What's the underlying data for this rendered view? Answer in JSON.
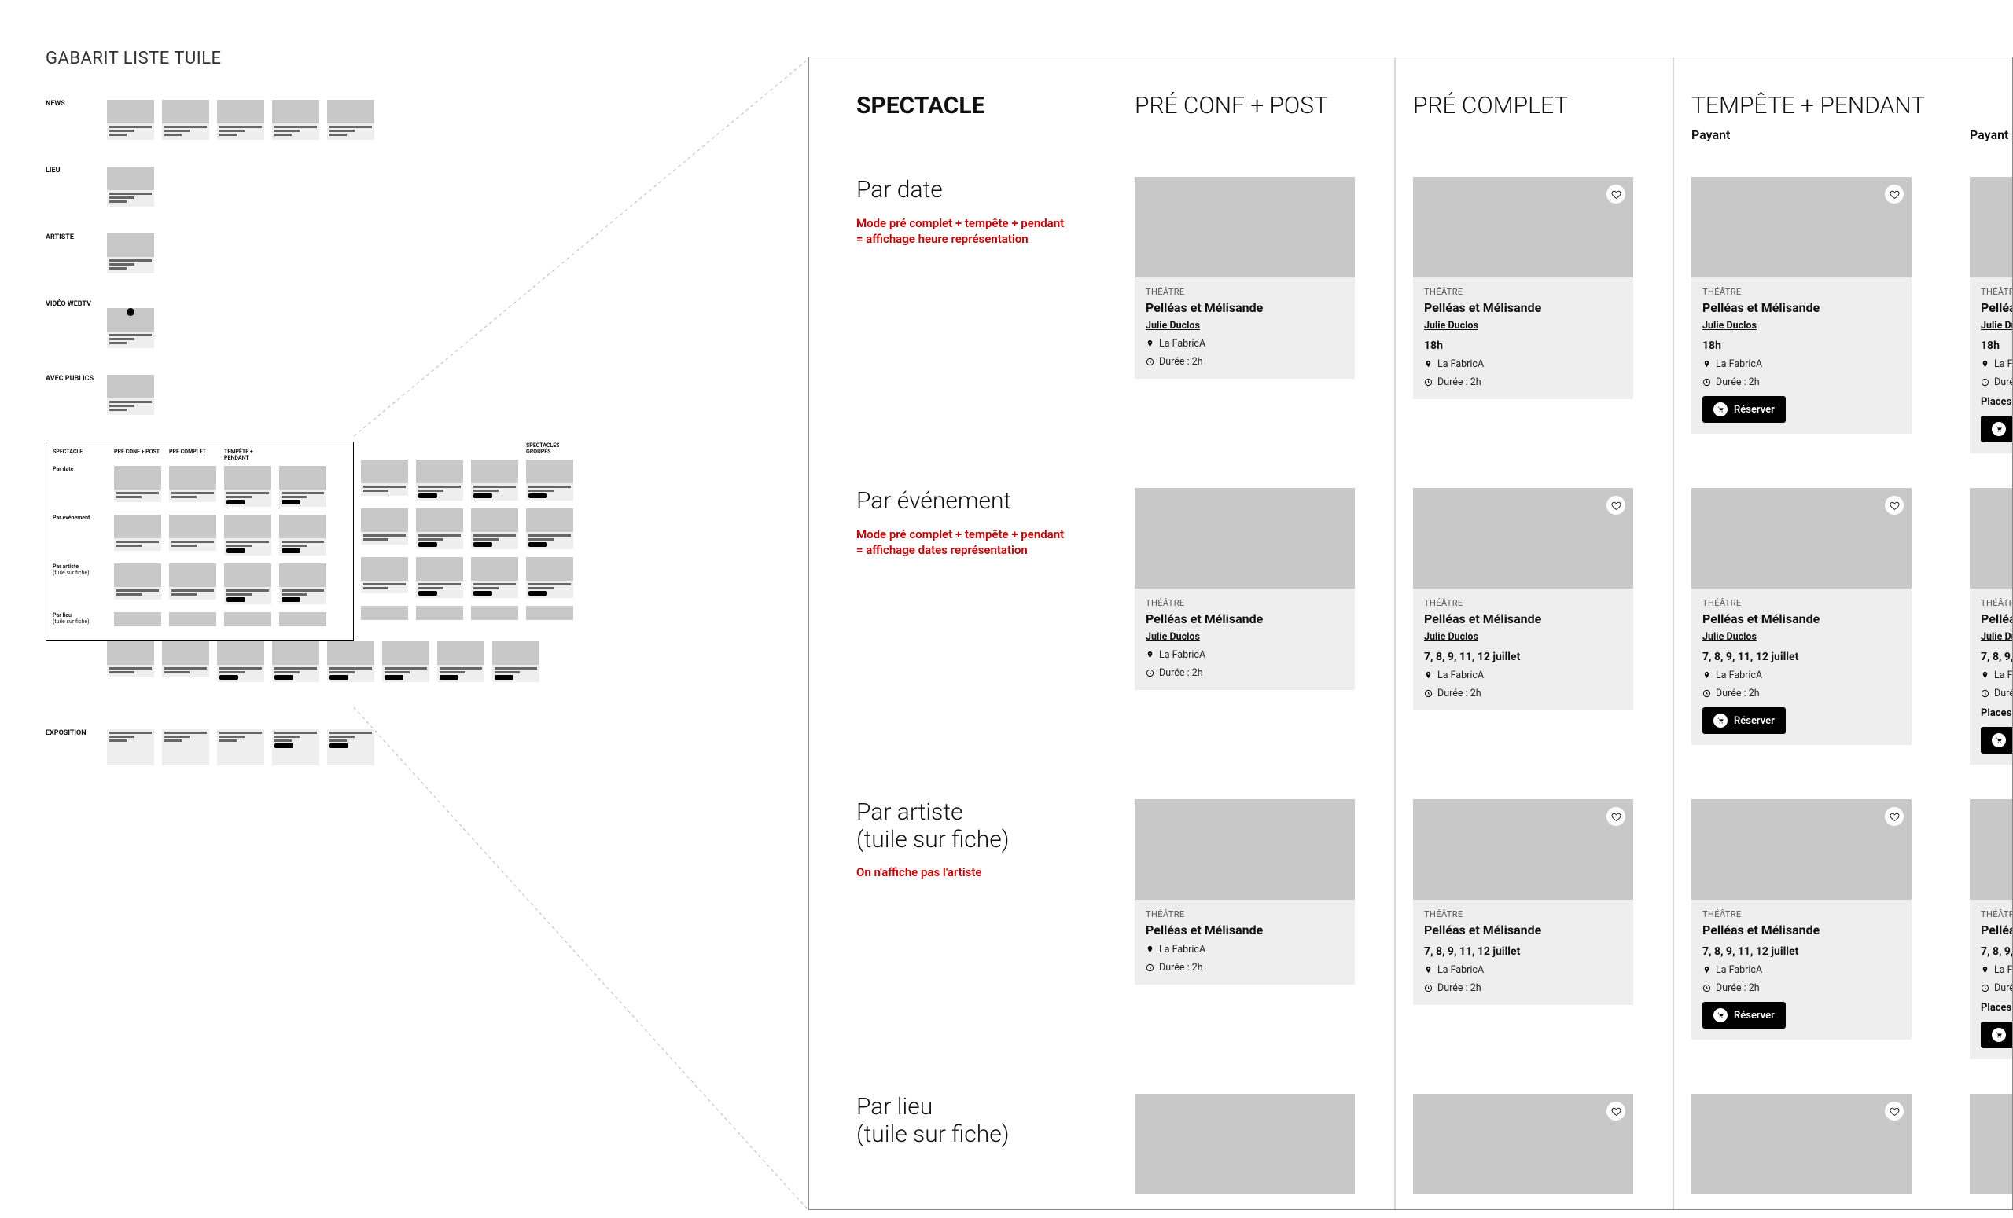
{
  "page_title": "GABARIT LISTE TUILE",
  "left": {
    "groups": [
      {
        "id": "news",
        "label": "NEWS"
      },
      {
        "id": "lieu",
        "label": "LIEU"
      },
      {
        "id": "artiste",
        "label": "ARTISTE"
      },
      {
        "id": "video",
        "label": "VIDÉO WEBTV"
      },
      {
        "id": "publics",
        "label": "AVEC PUBLICS"
      }
    ],
    "matrix": {
      "cols": [
        "SPECTACLE",
        "PRÉ CONF + POST",
        "PRÉ COMPLET",
        "TEMPÊTE + PENDANT",
        "",
        "",
        "",
        "SPECTACLES GROUPÉS"
      ],
      "rows": [
        "Par date",
        "Par événement",
        "Par artiste (tuile sur fiche)",
        "Par lieu (tuile sur fiche)"
      ]
    },
    "expo_label": "EXPOSITION"
  },
  "zoom": {
    "cols": [
      {
        "head": "SPECTACLE",
        "bold": true
      },
      {
        "head": "PRÉ CONF + POST"
      },
      {
        "head": "PRÉ COMPLET"
      },
      {
        "head": "TEMPÊTE + PENDANT",
        "sub": "Payant"
      },
      {
        "head": "",
        "sub": "Payant places remises en"
      }
    ],
    "rows": [
      {
        "id": "par-date",
        "title": "Par date",
        "note": "Mode pré complet + tempête + pendant\n= affichage heure représentation"
      },
      {
        "id": "par-evenement",
        "title": "Par événement",
        "note": "Mode pré complet + tempête + pendant\n= affichage dates représentation"
      },
      {
        "id": "par-artiste",
        "title": "Par artiste\n(tuile sur fiche)",
        "note": "On n'affiche pas l'artiste"
      },
      {
        "id": "par-lieu",
        "title": "Par lieu\n(tuile sur fiche)",
        "note": ""
      }
    ],
    "tile": {
      "cat": "THÉÂTRE",
      "title": "Pelléas et Mélisande",
      "artist": "Julie Duclos",
      "time": "18h",
      "dates": "7, 8, 9, 11, 12 juillet",
      "place": "La FabricA",
      "duration": "Durée : 2h",
      "alert": "Places remises en vente !",
      "btn": "Réserver"
    },
    "cards": {
      "par-date": [
        {
          "fav": false,
          "artist": true
        },
        {
          "fav": true,
          "artist": true,
          "time": true
        },
        {
          "fav": true,
          "artist": true,
          "time": true,
          "btn": true
        },
        {
          "fav": false,
          "artist": true,
          "time": true,
          "alert": true,
          "btn": true
        }
      ],
      "par-evenement": [
        {
          "fav": false,
          "artist": true
        },
        {
          "fav": true,
          "artist": true,
          "dates": true
        },
        {
          "fav": true,
          "artist": true,
          "dates": true,
          "btn": true
        },
        {
          "fav": false,
          "artist": true,
          "dates": true,
          "alert": true,
          "btn": true
        }
      ],
      "par-artiste": [
        {
          "fav": false
        },
        {
          "fav": true,
          "dates": true
        },
        {
          "fav": true,
          "dates": true,
          "btn": true
        },
        {
          "fav": false,
          "dates": true,
          "alert": true,
          "btn": true
        }
      ],
      "par-lieu": [
        {
          "fav": false,
          "imgonly": true
        },
        {
          "fav": true,
          "imgonly": true
        },
        {
          "fav": true,
          "imgonly": true
        },
        {
          "fav": false,
          "imgonly": true
        }
      ]
    }
  }
}
